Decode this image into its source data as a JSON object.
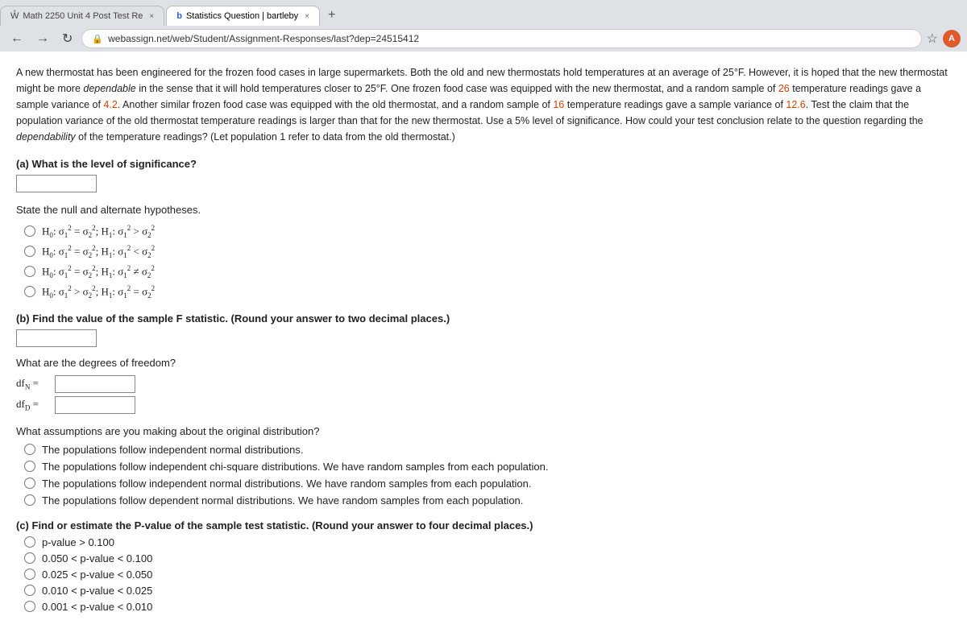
{
  "browser": {
    "tabs": [
      {
        "id": "tab1",
        "favicon": "W",
        "label": "Math 2250 Unit 4 Post Test Re",
        "active": false,
        "close": "×"
      },
      {
        "id": "tab2",
        "favicon": "b",
        "label": "Statistics Question | bartleby",
        "active": true,
        "close": "×"
      },
      {
        "id": "tab3",
        "label": "+",
        "active": false
      }
    ],
    "address": "webassign.net/web/Student/Assignment-Responses/last?dep=24515412",
    "lock_icon": "🔒"
  },
  "question": {
    "body": "A new thermostat has been engineered for the frozen food cases in large supermarkets. Both the old and new thermostats hold temperatures at an average of 25°F. However, it is hoped that the new thermostat might be more ",
    "dependable1": "dependable",
    "body2": " in the sense that it will hold temperatures closer to 25°F. One frozen food case was equipped with the new thermostat, and a random sample of ",
    "n1": "26",
    "body3": " temperature readings gave a sample variance of ",
    "var1": "4.2",
    "body4": ". Another similar frozen food case was equipped with the old thermostat, and a random sample of ",
    "n2": "16",
    "body5": " temperature readings gave a sample variance of ",
    "var2": "12.6",
    "body6": ". Test the claim that the population variance of the old thermostat temperature readings is larger than that for the new thermostat. Use a 5% level of significance. How could your test conclusion relate to the question regarding the ",
    "dependable2": "dependability",
    "body7": " of the temperature readings? (Let population 1 refer to data from the old thermostat.)",
    "part_a_label": "(a) What is the level of significance?",
    "state_hyp_label": "State the null and alternate hypotheses.",
    "hypotheses": [
      {
        "id": "h1",
        "text": "H₀: σ₁² = σ₂²; H₁: σ₁² > σ₂²"
      },
      {
        "id": "h2",
        "text": "H₀: σ₁² = σ₂²; H₁: σ₁² < σ₂²"
      },
      {
        "id": "h3",
        "text": "H₀: σ₁² = σ₂²; H₁: σ₁² ≠ σ₂²"
      },
      {
        "id": "h4",
        "text": "H₀: σ₁² > σ₂²; H₁: σ₁² = σ₂²"
      }
    ],
    "part_b_label": "(b) Find the value of the sample F statistic. (Round your answer to two decimal places.)",
    "degrees_label": "What are the degrees of freedom?",
    "dfN_label": "df_N =",
    "dfD_label": "df_D =",
    "assumptions_label": "What assumptions are you making about the original distribution?",
    "assumptions": [
      {
        "id": "a1",
        "text": "The populations follow independent normal distributions."
      },
      {
        "id": "a2",
        "text": "The populations follow independent chi-square distributions. We have random samples from each population."
      },
      {
        "id": "a3",
        "text": "The populations follow independent normal distributions. We have random samples from each population."
      },
      {
        "id": "a4",
        "text": "The populations follow dependent normal distributions. We have random samples from each population."
      }
    ],
    "part_c_label": "(c) Find or estimate the P-value of the sample test statistic. (Round your answer to four decimal places.)",
    "pvalues": [
      {
        "id": "p1",
        "text": "p-value > 0.100"
      },
      {
        "id": "p2",
        "text": "0.050 < p-value < 0.100"
      },
      {
        "id": "p3",
        "text": "0.025 < p-value < 0.050"
      },
      {
        "id": "p4",
        "text": "0.010 < p-value < 0.025"
      },
      {
        "id": "p5",
        "text": "0.001 < p-value < 0.010"
      }
    ]
  }
}
